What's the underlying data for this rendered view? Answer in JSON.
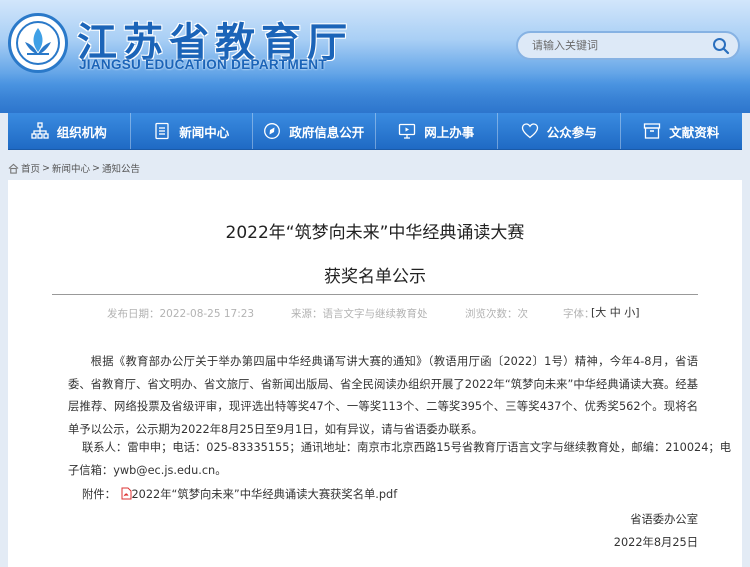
{
  "header": {
    "title": "江苏省教育厅",
    "subtitle": "JIANGSU EDUCATION DEPARTMENT",
    "search_placeholder": "请输入关键词"
  },
  "nav": {
    "items": [
      {
        "label": "组织机构",
        "icon": "org-chart-icon"
      },
      {
        "label": "新闻中心",
        "icon": "document-icon"
      },
      {
        "label": "政府信息公开",
        "icon": "compass-icon"
      },
      {
        "label": "网上办事",
        "icon": "monitor-icon"
      },
      {
        "label": "公众参与",
        "icon": "heart-icon"
      },
      {
        "label": "文献资料",
        "icon": "archive-icon"
      }
    ]
  },
  "breadcrumb": {
    "home": "首页",
    "sep1": ">",
    "level1": "新闻中心",
    "sep2": ">",
    "level2": "通知公告"
  },
  "article": {
    "title_line1": "2022年“筑梦向未来”中华经典诵读大赛",
    "title_line2": "获奖名单公示",
    "published": "发布日期：2022-08-25 17:23",
    "source": "来源：语言文字与继续教育处",
    "views": "浏览次数：次",
    "font_label": "字体：",
    "font_bracket_open": "[",
    "font_large": "大",
    "font_medium": "中",
    "font_small": "小",
    "font_bracket_close": "]",
    "paragraph": "根据《教育部办公厅关于举办第四届中华经典诵写讲大赛的通知》（教语用厅函〔2022〕1号）精神，今年4-8月，省语委、省教育厅、省文明办、省文旅厅、省新闻出版局、省全民阅读办组织开展了2022年“筑梦向未来”中华经典诵读大赛。经基层推荐、网络投票及省级评审，现评选出特等奖47个、一等奖113个、二等奖395个、三等奖437个、优秀奖562个。现将名单予以公示，公示期为2022年8月25日至9月1日，如有异议，请与省语委办联系。",
    "contact_line1": "联系人：雷申申；电话：025-83335155；通讯地址：南京市北京西路15号省教育厅语言文字与继续教育处，邮编：210024；电",
    "contact_line2": "子信箱：ywb@ec.js.edu.cn。",
    "attachment_label": "附件：",
    "attachment_name": "2022年“筑梦向未来”中华经典诵读大赛获奖名单.pdf",
    "signature_org": "省语委办公室",
    "signature_date": "2022年8月25日"
  },
  "colors": {
    "brand_blue": "#1b64b8",
    "nav_blue": "#2674cf"
  }
}
